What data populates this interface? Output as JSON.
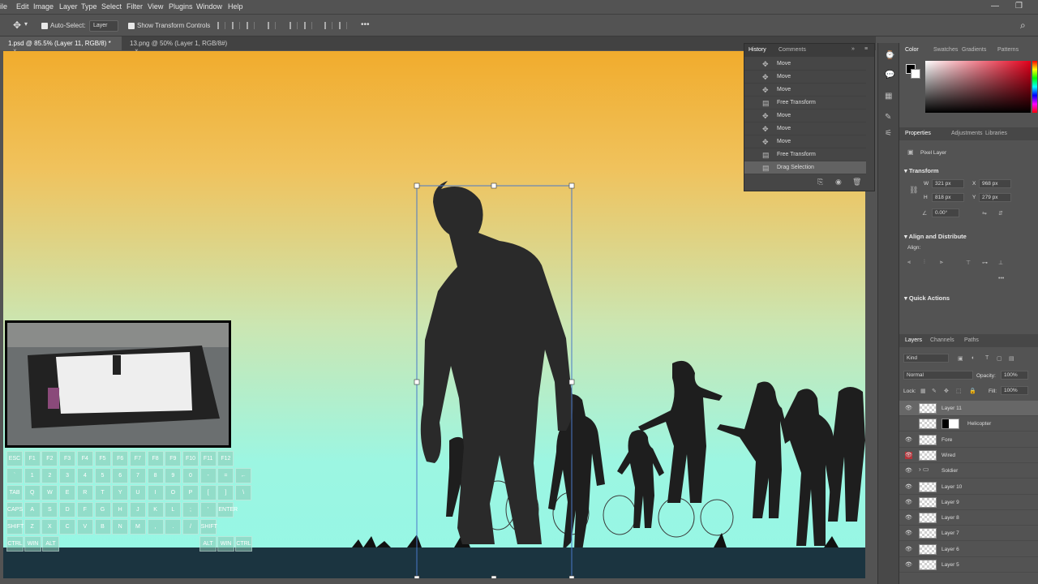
{
  "menu": [
    "ile",
    "Edit",
    "Image",
    "Layer",
    "Type",
    "Select",
    "Filter",
    "View",
    "Plugins",
    "Window",
    "Help"
  ],
  "options": {
    "auto_select_label": "Auto-Select:",
    "auto_select_value": "Layer",
    "show_transform_label": "Show Transform Controls",
    "more": "•••"
  },
  "tabs": [
    "1.psd @ 85.5% (Layer 11, RGB/8) *",
    "13.png @ 50% (Layer 1, RGB/8#)"
  ],
  "history": {
    "tabs": [
      "History",
      "Comments"
    ],
    "items": [
      "Move",
      "Move",
      "Move",
      "Free Transform",
      "Move",
      "Move",
      "Move",
      "Free Transform",
      "Drag Selection"
    ]
  },
  "color_panel": {
    "tabs": [
      "Color",
      "Swatches",
      "Gradients",
      "Patterns"
    ]
  },
  "properties": {
    "tabs": [
      "Properties",
      "Adjustments",
      "Libraries"
    ],
    "kind": "Pixel Layer",
    "transform_title": "Transform",
    "w_label": "W",
    "w": "321 px",
    "x_label": "X",
    "x": "968 px",
    "h_label": "H",
    "h": "818 px",
    "y_label": "Y",
    "y": "279 px",
    "angle": "0.00°",
    "align_title": "Align and Distribute",
    "align_label": "Align:",
    "quick_actions": "Quick Actions"
  },
  "layers": {
    "tabs": [
      "Layers",
      "Channels",
      "Paths"
    ],
    "filter": "Kind",
    "blend": "Normal",
    "opacity_label": "Opacity:",
    "opacity": "100%",
    "lock_label": "Lock:",
    "fill_label": "Fill:",
    "fill": "100%",
    "items": [
      "Layer 11",
      "Helicopter",
      "Fore",
      "Wired",
      "Soldier",
      "Layer 10",
      "Layer 9",
      "Layer 8",
      "Layer 7",
      "Layer 6",
      "Layer 5"
    ]
  },
  "keyboard": {
    "row1": [
      "ESC",
      "F1",
      "F2",
      "F3",
      "F4",
      "F5",
      "F6",
      "F7",
      "F8",
      "F9",
      "F10",
      "F11",
      "F12"
    ],
    "row2": [
      "`",
      "1",
      "2",
      "3",
      "4",
      "5",
      "6",
      "7",
      "8",
      "9",
      "0",
      "-",
      "=",
      "←"
    ],
    "row3": [
      "TAB",
      "Q",
      "W",
      "E",
      "R",
      "T",
      "Y",
      "U",
      "I",
      "O",
      "P",
      "[",
      "]",
      "\\"
    ],
    "row4": [
      "CAPS",
      "A",
      "S",
      "D",
      "F",
      "G",
      "H",
      "J",
      "K",
      "L",
      ";",
      "'",
      "ENTER"
    ],
    "row5": [
      "SHIFT",
      "Z",
      "X",
      "C",
      "V",
      "B",
      "N",
      "M",
      ",",
      ".",
      "/",
      "SHIFT"
    ],
    "row6": [
      "CTRL",
      "WIN",
      "ALT",
      "ALT",
      "WIN",
      "CTRL"
    ]
  },
  "colors": {
    "canvas_top": "#f1ac2d",
    "canvas_bottom": "#95f7e5",
    "ground": "#1b3440",
    "silhouette": "#2a2a2a"
  }
}
